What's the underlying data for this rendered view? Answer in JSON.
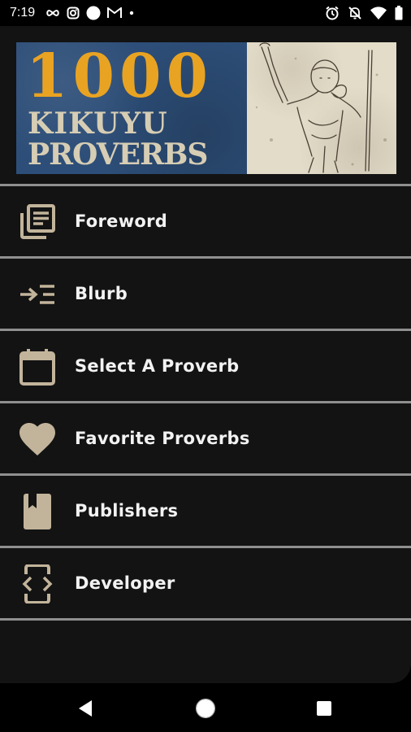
{
  "status_bar": {
    "time": "7:19",
    "left_icons": [
      "infinity-icon",
      "instagram-icon",
      "circle-icon",
      "gmail-icon",
      "dot-icon"
    ],
    "right_icons": [
      "alarm-icon",
      "notifications-off-icon",
      "wifi-icon",
      "battery-icon"
    ]
  },
  "banner": {
    "number": "1000",
    "line1": "KIKUYU",
    "line2": "PROVERBS",
    "colors": {
      "number": "#e9a322",
      "text": "#d6cdb4",
      "panel": "#2d4e78"
    }
  },
  "menu": {
    "items": [
      {
        "label": "Foreword",
        "icon": "library-books-icon"
      },
      {
        "label": "Blurb",
        "icon": "indent-arrow-icon"
      },
      {
        "label": "Select A Proverb",
        "icon": "calendar-icon"
      },
      {
        "label": "Favorite Proverbs",
        "icon": "heart-icon"
      },
      {
        "label": "Publishers",
        "icon": "book-bookmark-icon"
      },
      {
        "label": "Developer",
        "icon": "developer-mode-icon"
      }
    ],
    "icon_color": "#c2b49b"
  },
  "nav_bar": {
    "buttons": [
      "back-icon",
      "home-icon",
      "recents-icon"
    ]
  }
}
